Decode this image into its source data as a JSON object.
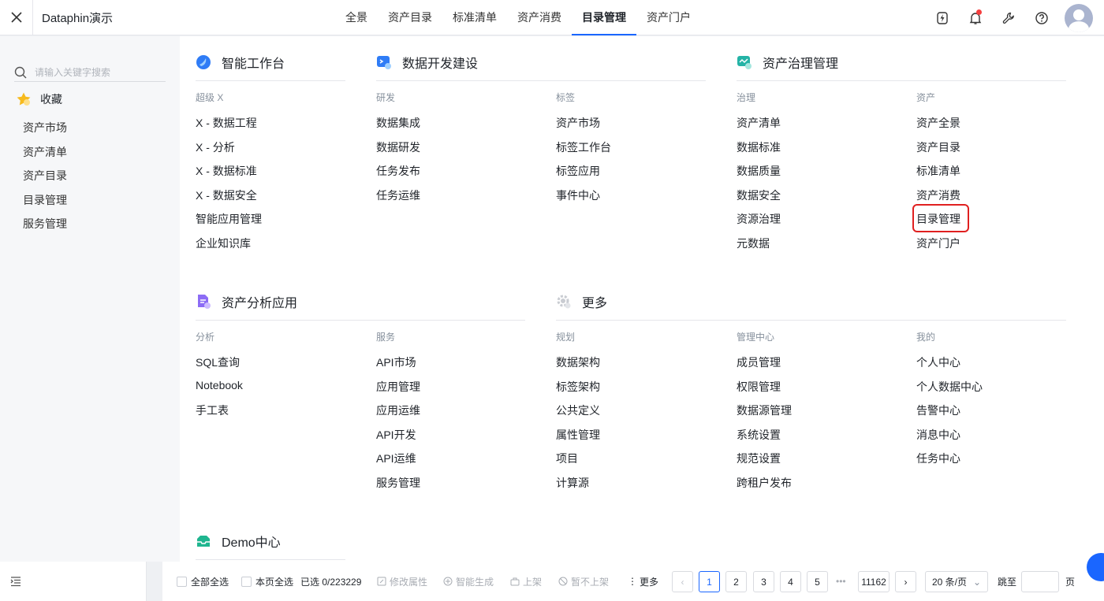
{
  "app": {
    "title": "Dataphin演示"
  },
  "nav": {
    "tabs": [
      "全景",
      "资产目录",
      "标准清单",
      "资产消费",
      "目录管理",
      "资产门户"
    ],
    "active": "目录管理"
  },
  "sidebar": {
    "search_placeholder": "请输入关键字搜索",
    "favorites_label": "收藏",
    "items": [
      "资产市场",
      "资产清单",
      "资产目录",
      "目录管理",
      "服务管理"
    ]
  },
  "sections": {
    "smart": {
      "title": "智能工作台",
      "category": "超级 X",
      "links": [
        "X - 数据工程",
        "X - 分析",
        "X - 数据标准",
        "X - 数据安全",
        "智能应用管理",
        "企业知识库"
      ]
    },
    "dev": {
      "title": "数据开发建设",
      "cat1": "研发",
      "links1": [
        "数据集成",
        "数据研发",
        "任务发布",
        "任务运维"
      ],
      "cat2": "标签",
      "links2": [
        "资产市场",
        "标签工作台",
        "标签应用",
        "事件中心"
      ]
    },
    "gov": {
      "title": "资产治理管理",
      "cat1": "治理",
      "links1": [
        "资产清单",
        "数据标准",
        "数据质量",
        "数据安全",
        "资源治理",
        "元数据"
      ],
      "cat2": "资产",
      "links2": [
        "资产全景",
        "资产目录",
        "标准清单",
        "资产消费",
        "目录管理",
        "资产门户"
      ],
      "highlighted": "目录管理"
    },
    "analysis": {
      "title": "资产分析应用",
      "cat1": "分析",
      "links1": [
        "SQL查询",
        "Notebook",
        "手工表"
      ],
      "cat2": "服务",
      "links2": [
        "API市场",
        "应用管理",
        "应用运维",
        "API开发",
        "API运维",
        "服务管理"
      ]
    },
    "more": {
      "title": "更多",
      "cat1": "规划",
      "links1": [
        "数据架构",
        "标签架构",
        "公共定义",
        "属性管理",
        "项目",
        "计算源"
      ],
      "cat2": "管理中心",
      "links2": [
        "成员管理",
        "权限管理",
        "数据源管理",
        "系统设置",
        "规范设置",
        "跨租户发布"
      ],
      "cat3": "我的",
      "links3": [
        "个人中心",
        "个人数据中心",
        "告警中心",
        "消息中心",
        "任务中心"
      ]
    },
    "demo": {
      "title": "Demo中心"
    }
  },
  "bottom": {
    "select_all": "全部全选",
    "select_page": "本页全选",
    "selected": "已选 0/223229",
    "actions": [
      "修改属性",
      "智能生成",
      "上架",
      "暂不上架"
    ],
    "more": "更多",
    "pages": [
      "1",
      "2",
      "3",
      "4",
      "5"
    ],
    "ellipsis": "•••",
    "last_page": "11162",
    "current_page": 1,
    "page_size": "20 条/页",
    "jump_label": "跳至",
    "page_suffix": "页"
  },
  "colors": {
    "accent": "#1a66ff",
    "highlight_border": "#e02020",
    "notification_dot": "#f53f3f"
  },
  "icons": [
    "close-icon",
    "lightning-icon",
    "bell-icon",
    "wrench-icon",
    "help-icon",
    "avatar",
    "search-icon",
    "star-icon",
    "list-icon"
  ]
}
